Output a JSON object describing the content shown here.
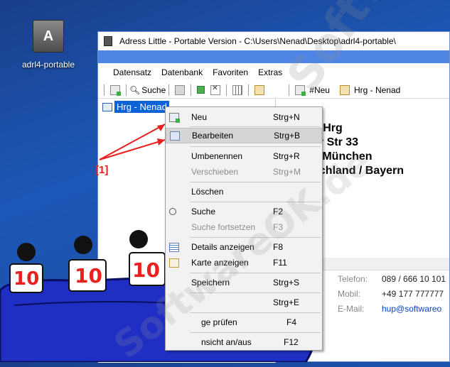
{
  "desktop": {
    "icon_label": "adrl4-portable",
    "icon_glyph": "A"
  },
  "window": {
    "title": "Adress Little - Portable Version - C:\\Users\\Nenad\\Desktop\\adrl4-portable\\",
    "menu": [
      "Datensatz",
      "Datenbank",
      "Favoriten",
      "Extras"
    ],
    "toolbar_left": {
      "search_label": "Suche"
    },
    "toolbar_right": {
      "new_label": "#Neu",
      "record_label": "Hrg - Nenad"
    }
  },
  "tree": {
    "selected_item": "Hrg - Nenad"
  },
  "detail": {
    "address_lines": [
      "d Hrg",
      "er Str 33",
      "3 München",
      "schland / Bayern"
    ],
    "section_label": "rat",
    "contacts": [
      {
        "label": "Telefon:",
        "value": "089 / 666 10 101"
      },
      {
        "label": "Mobil:",
        "value": "+49 177 777777"
      },
      {
        "label": "E-Mail:",
        "value": "hup@softwareo"
      }
    ]
  },
  "context_menu": {
    "items": [
      {
        "label": "Neu",
        "shortcut": "Strg+N",
        "icon": "new-record-icon",
        "disabled": false,
        "highlight": false
      },
      {
        "label": "Bearbeiten",
        "shortcut": "Strg+B",
        "icon": "edit-record-icon",
        "disabled": false,
        "highlight": true
      },
      {
        "label": "Umbenennen",
        "shortcut": "Strg+R",
        "icon": "",
        "disabled": false,
        "highlight": false
      },
      {
        "label": "Verschieben",
        "shortcut": "Strg+M",
        "icon": "",
        "disabled": true,
        "highlight": false
      },
      {
        "label": "Löschen",
        "shortcut": "",
        "icon": "",
        "disabled": false,
        "highlight": false
      },
      {
        "label": "Suche",
        "shortcut": "F2",
        "icon": "search-icon",
        "disabled": false,
        "highlight": false
      },
      {
        "label": "Suche fortsetzen",
        "shortcut": "F3",
        "icon": "",
        "disabled": true,
        "highlight": false
      },
      {
        "label": "Details anzeigen",
        "shortcut": "F8",
        "icon": "details-icon",
        "disabled": false,
        "highlight": false
      },
      {
        "label": "Karte anzeigen",
        "shortcut": "F11",
        "icon": "card-icon",
        "disabled": false,
        "highlight": false
      },
      {
        "label": "Speichern",
        "shortcut": "Strg+S",
        "icon": "",
        "disabled": false,
        "highlight": false
      },
      {
        "label": "",
        "shortcut": "Strg+E",
        "icon": "",
        "disabled": false,
        "highlight": false
      },
      {
        "label": "ge prüfen",
        "shortcut": "F4",
        "icon": "",
        "disabled": false,
        "highlight": false
      },
      {
        "label": "nsicht an/aus",
        "shortcut": "F12",
        "icon": "",
        "disabled": false,
        "highlight": false
      }
    ]
  },
  "annotation": {
    "label": "[1]",
    "color": "#e8201e"
  },
  "decoration": {
    "badges": [
      "10",
      "10",
      "10"
    ],
    "watermark": "SoftwareOK.de"
  },
  "colors": {
    "selection": "#0a64d6",
    "titlebar_accent": "#4f86e6",
    "couch": "#1f2fc4"
  }
}
